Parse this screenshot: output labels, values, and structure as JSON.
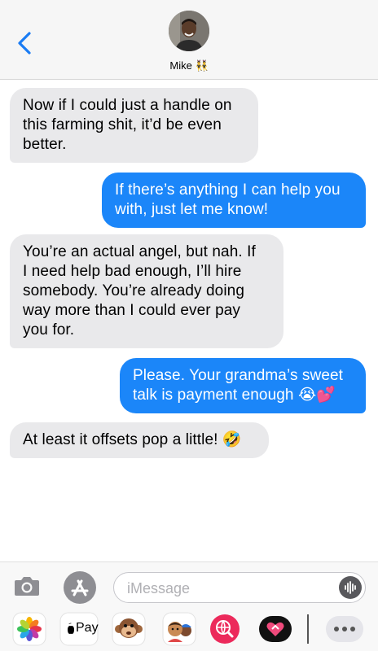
{
  "header": {
    "contact_name": "Mike",
    "name_emoji": "👯‍♂️"
  },
  "messages": [
    {
      "direction": "incoming",
      "lines": [
        "Now if I could just a handle on",
        "this farming shit, it’d be even",
        "better."
      ]
    },
    {
      "direction": "outgoing",
      "lines": [
        "If there’s anything I can help you",
        "with, just let me know!"
      ]
    },
    {
      "direction": "incoming",
      "lines": [
        "You’re an actual angel, but nah. If",
        "I need help bad enough, I’ll hire",
        "somebody. You’re already doing",
        "way more than I could ever pay",
        "you for."
      ]
    },
    {
      "direction": "outgoing",
      "lines": [
        "Please. Your grandma’s sweet",
        "talk is payment enough 😭💕"
      ]
    },
    {
      "direction": "incoming",
      "lines": [
        "At least it offsets pop a little! 🤣"
      ]
    }
  ],
  "composer": {
    "placeholder": "iMessage",
    "value": ""
  },
  "app_drawer": {
    "apple_pay_label": "Pay",
    "items": [
      "photos-icon",
      "apple-pay-icon",
      "animoji-icon",
      "memoji-icon",
      "web-search-icon",
      "digital-touch-icon",
      "more-apps-icon"
    ]
  },
  "colors": {
    "outgoing_bubble": "#1b86f9",
    "incoming_bubble": "#e9e9eb",
    "accent": "#1a7cf4"
  }
}
